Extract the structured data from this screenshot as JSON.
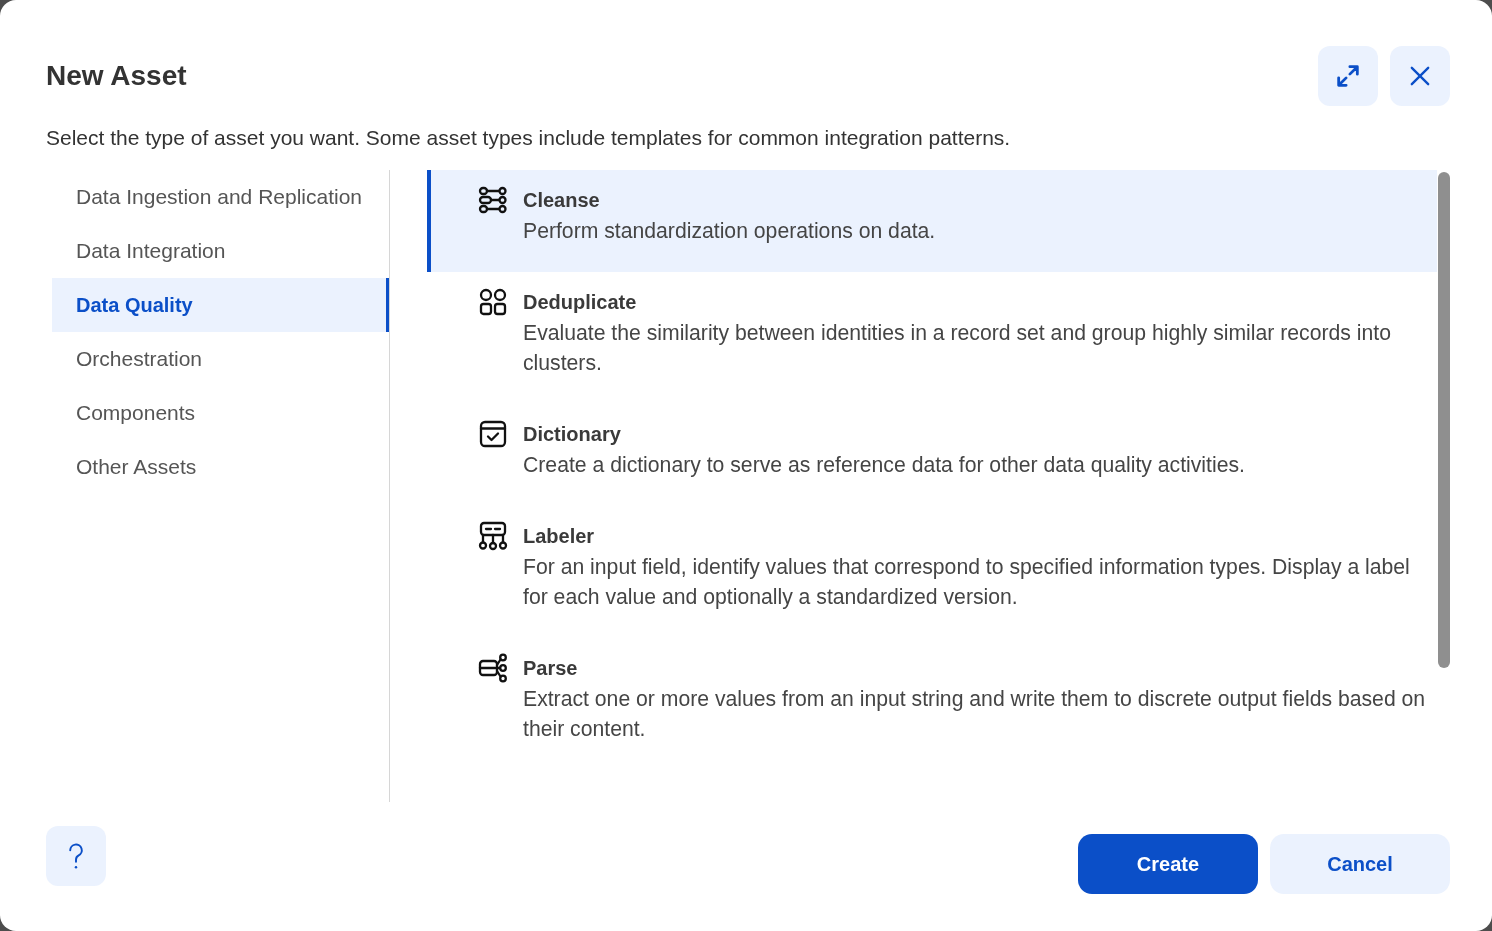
{
  "dialog": {
    "title": "New Asset",
    "description": "Select the type of asset you want. Some asset types include templates for common integration patterns."
  },
  "categories": [
    {
      "label": "Data Ingestion and Replication",
      "selected": false
    },
    {
      "label": "Data Integration",
      "selected": false
    },
    {
      "label": "Data Quality",
      "selected": true
    },
    {
      "label": "Orchestration",
      "selected": false
    },
    {
      "label": "Components",
      "selected": false
    },
    {
      "label": "Other Assets",
      "selected": false
    }
  ],
  "asset_types": [
    {
      "kind": "cleanse",
      "name": "Cleanse",
      "description": "Perform standardization operations on data.",
      "selected": true
    },
    {
      "kind": "deduplicate",
      "name": "Deduplicate",
      "description": "Evaluate the similarity between identities in a record set and group highly similar records into clusters.",
      "selected": false
    },
    {
      "kind": "dictionary",
      "name": "Dictionary",
      "description": "Create a dictionary to serve as reference data for other data quality activities.",
      "selected": false
    },
    {
      "kind": "labeler",
      "name": "Labeler",
      "description": "For an input field, identify values that correspond to specified information types. Display a label for each value and optionally a standardized version.",
      "selected": false
    },
    {
      "kind": "parse",
      "name": "Parse",
      "description": "Extract one or more values from an input string and write them to discrete output fields based on their content.",
      "selected": false
    }
  ],
  "buttons": [
    {
      "kind": "primary",
      "label": "Create"
    },
    {
      "kind": "secondary",
      "label": "Cancel"
    }
  ]
}
